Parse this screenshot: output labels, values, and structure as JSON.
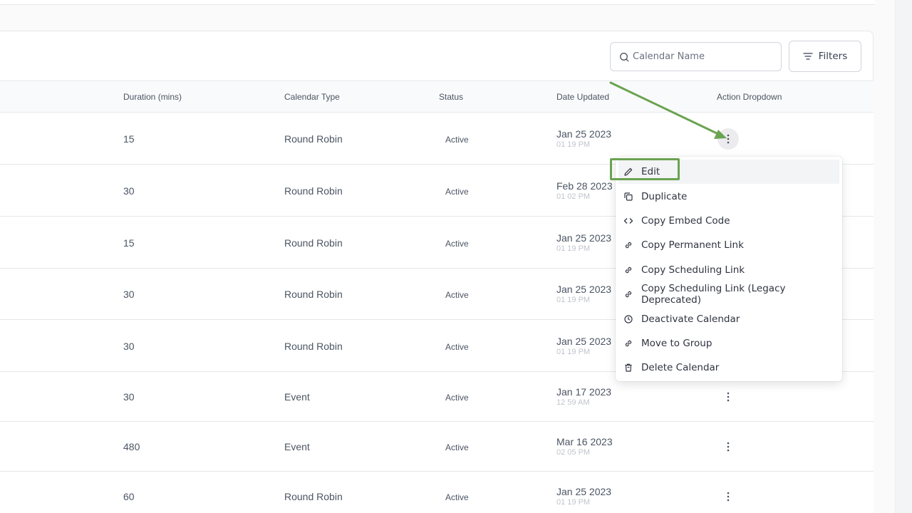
{
  "search": {
    "placeholder": "Calendar Name"
  },
  "toolbar": {
    "filters_label": "Filters"
  },
  "table": {
    "headers": {
      "duration": "Duration (mins)",
      "type": "Calendar Type",
      "status": "Status",
      "date": "Date Updated",
      "action": "Action Dropdown"
    },
    "rows": [
      {
        "duration": "15",
        "type": "Round Robin",
        "status": "Active",
        "date": "Jan 25 2023",
        "time": "01 19 PM"
      },
      {
        "duration": "30",
        "type": "Round Robin",
        "status": "Active",
        "date": "Feb 28 2023",
        "time": "01 02 PM"
      },
      {
        "duration": "15",
        "type": "Round Robin",
        "status": "Active",
        "date": "Jan 25 2023",
        "time": "01 19 PM"
      },
      {
        "duration": "30",
        "type": "Round Robin",
        "status": "Active",
        "date": "Jan 25 2023",
        "time": "01 19 PM"
      },
      {
        "duration": "30",
        "type": "Round Robin",
        "status": "Active",
        "date": "Jan 25 2023",
        "time": "01 19 PM"
      },
      {
        "duration": "30",
        "type": "Event",
        "status": "Active",
        "date": "Jan 17 2023",
        "time": "12 59 AM"
      },
      {
        "duration": "480",
        "type": "Event",
        "status": "Active",
        "date": "Mar 16 2023",
        "time": "02 05 PM"
      },
      {
        "duration": "60",
        "type": "Round Robin",
        "status": "Active",
        "date": "Jan 25 2023",
        "time": "01 19 PM"
      }
    ]
  },
  "menu": {
    "items": [
      {
        "label": "Edit",
        "icon": "pencil-icon"
      },
      {
        "label": "Duplicate",
        "icon": "copy-icon"
      },
      {
        "label": "Copy Embed Code",
        "icon": "code-icon"
      },
      {
        "label": "Copy Permanent Link",
        "icon": "link-icon"
      },
      {
        "label": "Copy Scheduling Link",
        "icon": "link-icon"
      },
      {
        "label": "Copy Scheduling Link (Legacy Deprecated)",
        "icon": "link-icon"
      },
      {
        "label": "Deactivate Calendar",
        "icon": "clock-icon"
      },
      {
        "label": "Move to Group",
        "icon": "link-icon"
      },
      {
        "label": "Delete Calendar",
        "icon": "trash-icon"
      }
    ]
  },
  "colors": {
    "highlight": "#6aa351",
    "border": "#e5e7eb",
    "text": "#4b5563"
  }
}
